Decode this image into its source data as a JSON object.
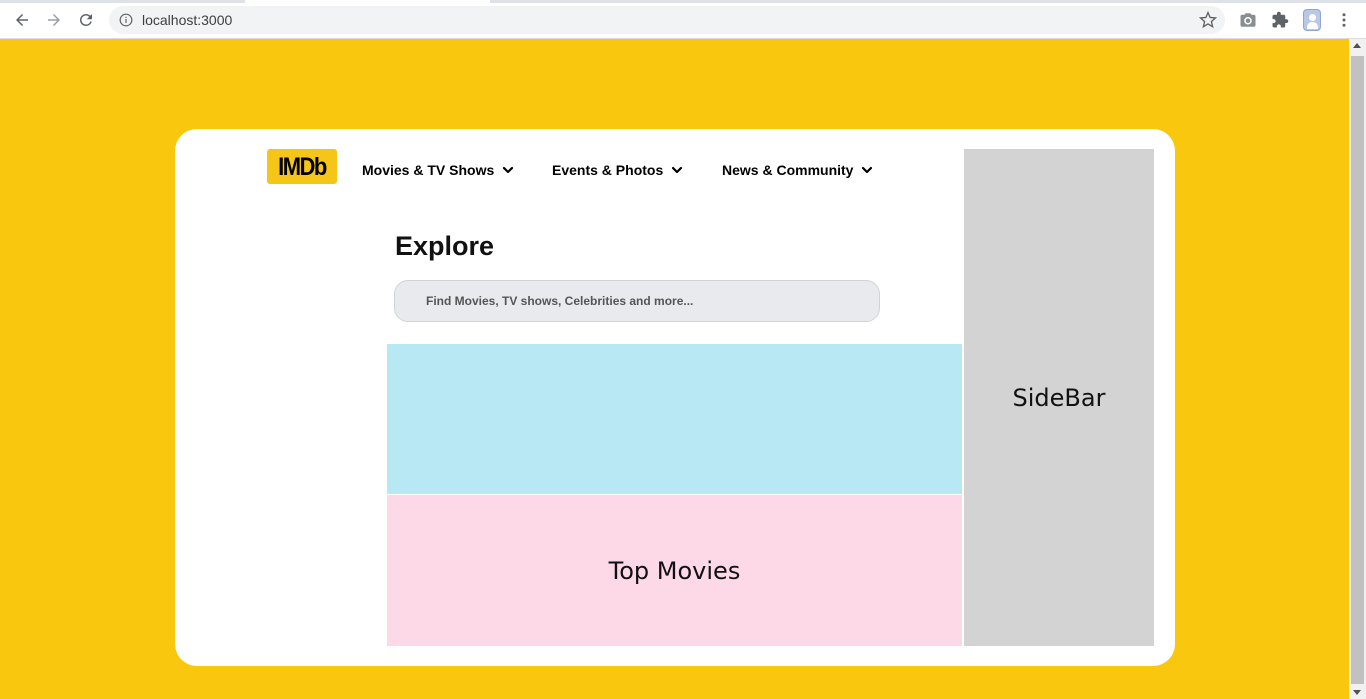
{
  "browser": {
    "url": "localhost:3000",
    "icons": [
      "back-icon",
      "forward-icon",
      "reload-icon",
      "info-icon",
      "star-icon",
      "camera-icon",
      "extensions-icon",
      "avatar",
      "menu-icon"
    ]
  },
  "header": {
    "logo_text": "IMDb",
    "nav": [
      {
        "label": "Movies & TV Shows"
      },
      {
        "label": "Events & Photos"
      },
      {
        "label": "News & Community"
      }
    ]
  },
  "main": {
    "title": "Explore",
    "search_placeholder": "Find Movies, TV shows, Celebrities and more...",
    "top_movies_label": "Top Movies"
  },
  "sidebar": {
    "label": "SideBar"
  },
  "colors": {
    "page_background": "#f9c70e",
    "logo": "#f5c518",
    "feature_block": "#b9e8f5",
    "top_movies": "#fdd9e7",
    "sidebar": "#d3d3d3"
  }
}
